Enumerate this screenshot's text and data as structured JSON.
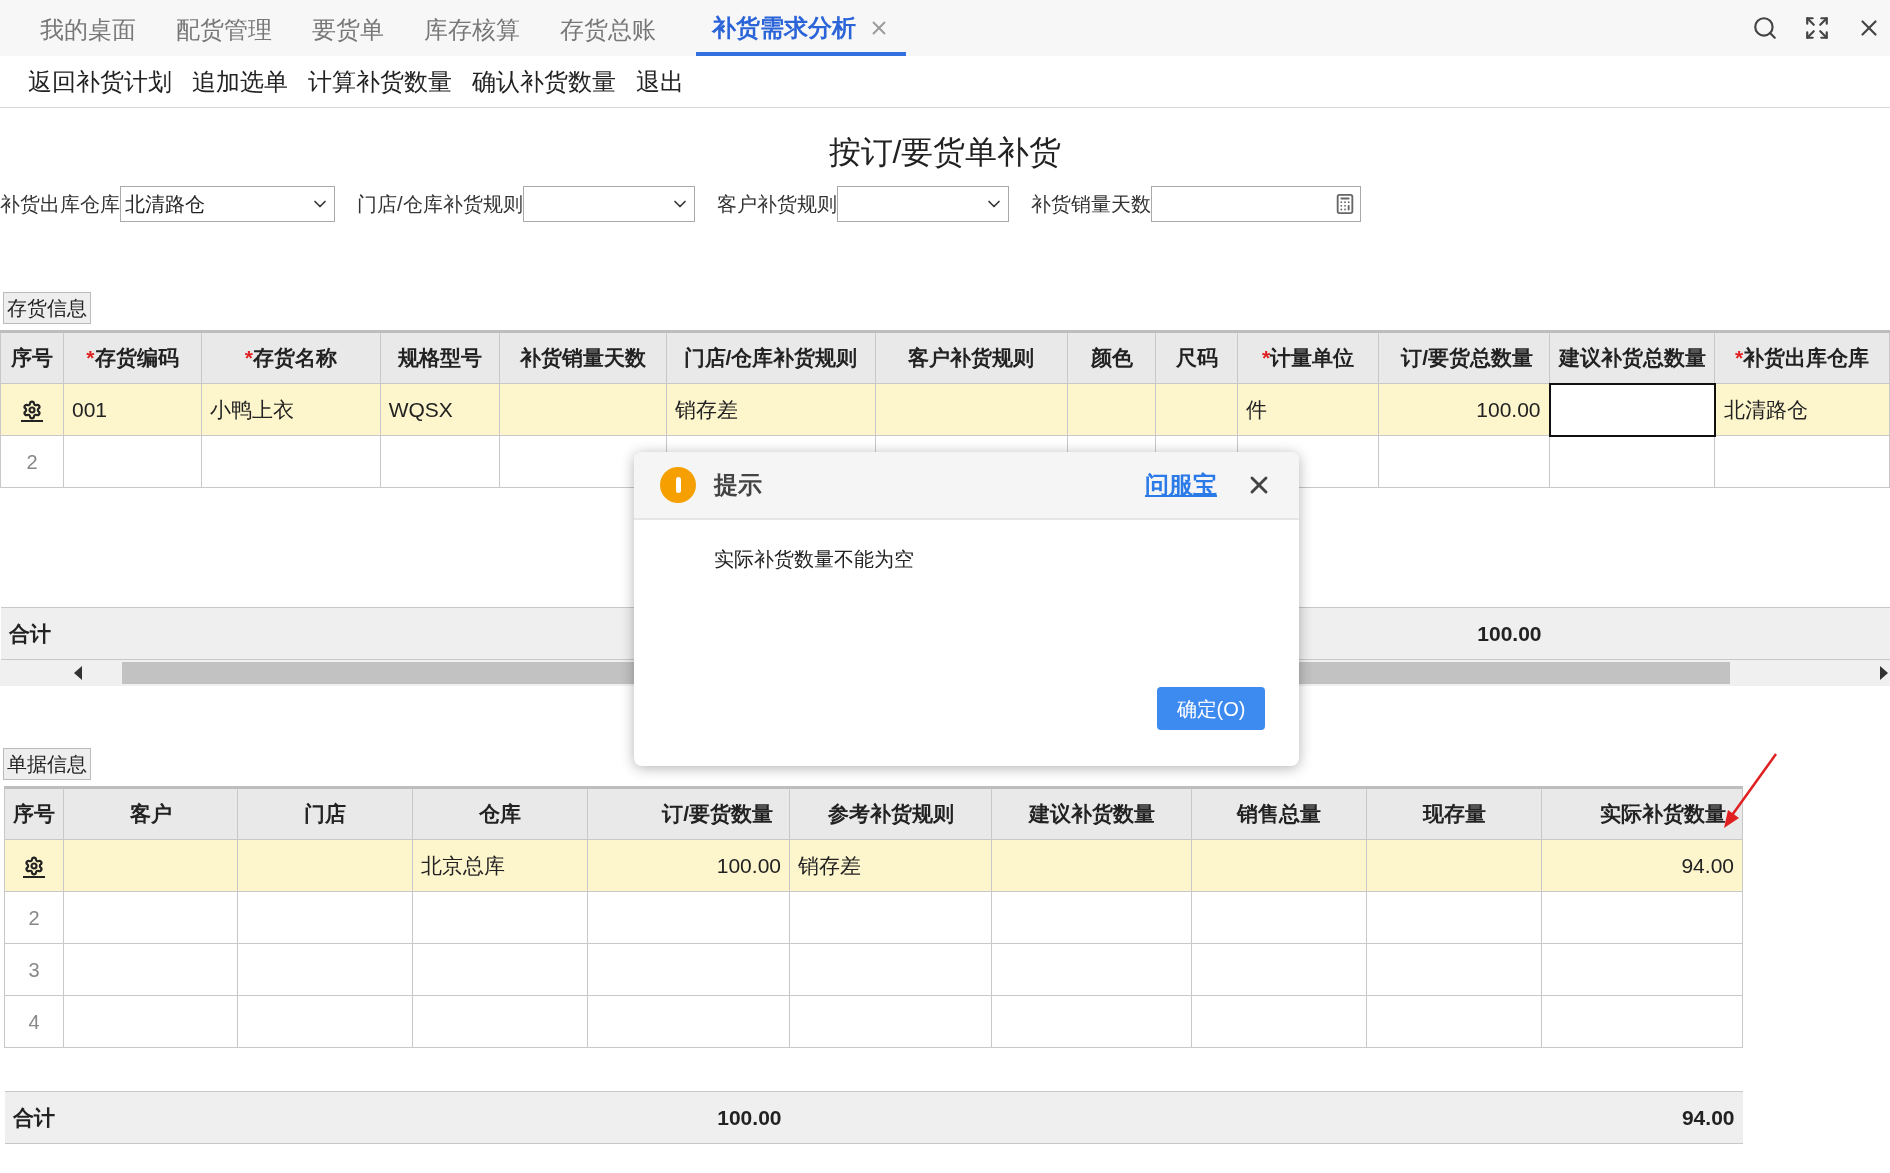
{
  "tabs": [
    {
      "label": "我的桌面",
      "selected": false,
      "closable": false
    },
    {
      "label": "配货管理",
      "selected": false,
      "closable": false
    },
    {
      "label": "要货单",
      "selected": false,
      "closable": false
    },
    {
      "label": "库存核算",
      "selected": false,
      "closable": false
    },
    {
      "label": "存货总账",
      "selected": false,
      "closable": false
    },
    {
      "label": "补货需求分析",
      "selected": true,
      "closable": true
    }
  ],
  "toolbar": [
    "返回补货计划",
    "追加选单",
    "计算补货数量",
    "确认补货数量",
    "退出"
  ],
  "title": "按订/要货单补货",
  "filters": [
    {
      "label": "补货出库仓库",
      "kind": "select",
      "value": "北清路仓"
    },
    {
      "label": "门店/仓库补货规则",
      "kind": "select"
    },
    {
      "label": "客户补货规则",
      "kind": "select"
    },
    {
      "label": "补货销量天数",
      "kind": "calculator"
    }
  ],
  "inventory": {
    "section_label": "存货信息",
    "columns": [
      {
        "label": "序号"
      },
      {
        "label": "存货编码",
        "mark": "*"
      },
      {
        "label": "存货名称",
        "mark": "*"
      },
      {
        "label": "规格型号"
      },
      {
        "label": "补货销量天数"
      },
      {
        "label": "门店/仓库补货规则"
      },
      {
        "label": "客户补货规则"
      },
      {
        "label": "颜色"
      },
      {
        "label": "尺码"
      },
      {
        "label": "计量单位",
        "mark": "*"
      },
      {
        "label": "订/要货总数量"
      },
      {
        "label": "建议补货总数量"
      },
      {
        "label": "补货出库仓库",
        "mark": "*"
      }
    ],
    "rows": [
      {
        "kind": "item",
        "selected": true,
        "cells": [
          null,
          "001",
          "小鸭上衣",
          "WQSX",
          null,
          "销存差",
          null,
          null,
          null,
          "件",
          "100.00",
          {
            "focused": true
          },
          "北清路仓"
        ]
      },
      {
        "kind": "item",
        "selected": false,
        "cells": [
          "2",
          null,
          null,
          null,
          null,
          null,
          null,
          null,
          null,
          null,
          null,
          null,
          null
        ]
      },
      {
        "kind": "total",
        "cells": [
          "合计",
          null,
          null,
          null,
          null,
          null,
          null,
          null,
          null,
          null,
          "100.00",
          null,
          null
        ]
      }
    ]
  },
  "documents": {
    "section_label": "单据信息",
    "columns": [
      {
        "label": "序号"
      },
      {
        "label": "客户"
      },
      {
        "label": "门店"
      },
      {
        "label": "仓库"
      },
      {
        "label": "订/要货数量"
      },
      {
        "label": "参考补货规则"
      },
      {
        "label": "建议补货数量"
      },
      {
        "label": "销售总量"
      },
      {
        "label": "现存量"
      },
      {
        "label": "实际补货数量"
      }
    ],
    "rows": [
      {
        "kind": "item",
        "selected": true,
        "cells": [
          null,
          null,
          null,
          "北京总库",
          "100.00",
          "销存差",
          null,
          null,
          null,
          "94.00"
        ]
      },
      {
        "kind": "item",
        "selected": false,
        "cells": [
          "2",
          null,
          null,
          null,
          null,
          null,
          null,
          null,
          null,
          null
        ]
      },
      {
        "kind": "item",
        "selected": false,
        "cells": [
          "3",
          null,
          null,
          null,
          null,
          null,
          null,
          null,
          null,
          null
        ]
      },
      {
        "kind": "item",
        "selected": false,
        "cells": [
          "4",
          null,
          null,
          null,
          null,
          null,
          null,
          null,
          null,
          null
        ]
      },
      {
        "kind": "total",
        "cells": [
          "合计",
          null,
          null,
          null,
          "100.00",
          null,
          null,
          null,
          null,
          "94.00"
        ]
      }
    ]
  },
  "dialog": {
    "title": "提示",
    "link": "问服宝",
    "message": "实际补货数量不能为空",
    "button": "确定(O)"
  }
}
